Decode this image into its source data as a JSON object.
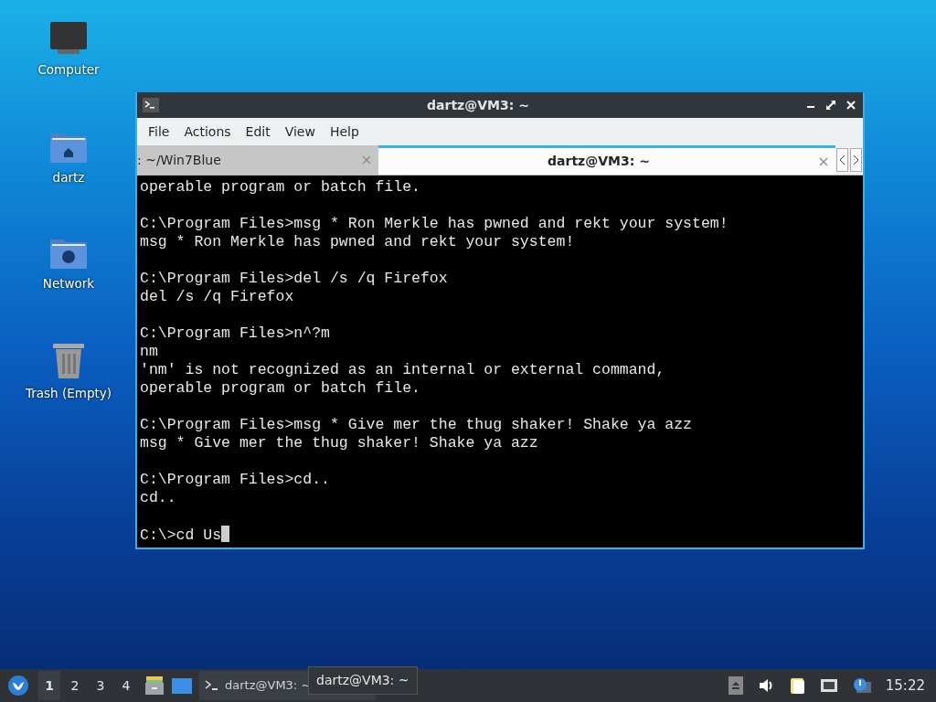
{
  "desktop_icons": [
    {
      "kind": "computer",
      "label": "Computer"
    },
    {
      "kind": "home",
      "label": "dartz"
    },
    {
      "kind": "network",
      "label": "Network"
    },
    {
      "kind": "trash",
      "label": "Trash (Empty)"
    }
  ],
  "window": {
    "title": "dartz@VM3: ~",
    "menu": [
      "File",
      "Actions",
      "Edit",
      "View",
      "Help"
    ],
    "tabs": [
      {
        "label": ": ~/Win7Blue",
        "selected": false
      },
      {
        "label": "dartz@VM3: ~",
        "selected": true
      }
    ],
    "terminal_blocks": [
      [
        "operable program or batch file."
      ],
      [
        "C:\\Program Files>msg * Ron Merkle has pwned and rekt your system!",
        "msg * Ron Merkle has pwned and rekt your system!"
      ],
      [
        "C:\\Program Files>del /s /q Firefox",
        "del /s /q Firefox"
      ],
      [
        "C:\\Program Files>n^?m",
        "nm",
        "'nm' is not recognized as an internal or external command,",
        "operable program or batch file."
      ],
      [
        "C:\\Program Files>msg * Give mer the thug shaker! Shake ya azz",
        "msg * Give mer the thug shaker! Shake ya azz"
      ],
      [
        "C:\\Program Files>cd..",
        "cd.."
      ],
      [
        "C:\\>cd Us"
      ]
    ]
  },
  "taskbar": {
    "workspaces": [
      {
        "label": "1",
        "selected": true
      },
      {
        "label": "2",
        "selected": false
      },
      {
        "label": "3",
        "selected": false
      },
      {
        "label": "4",
        "selected": false
      }
    ],
    "task": "dartz@VM3: ~",
    "tooltip": "dartz@VM3: ~",
    "clock": "15:22"
  }
}
